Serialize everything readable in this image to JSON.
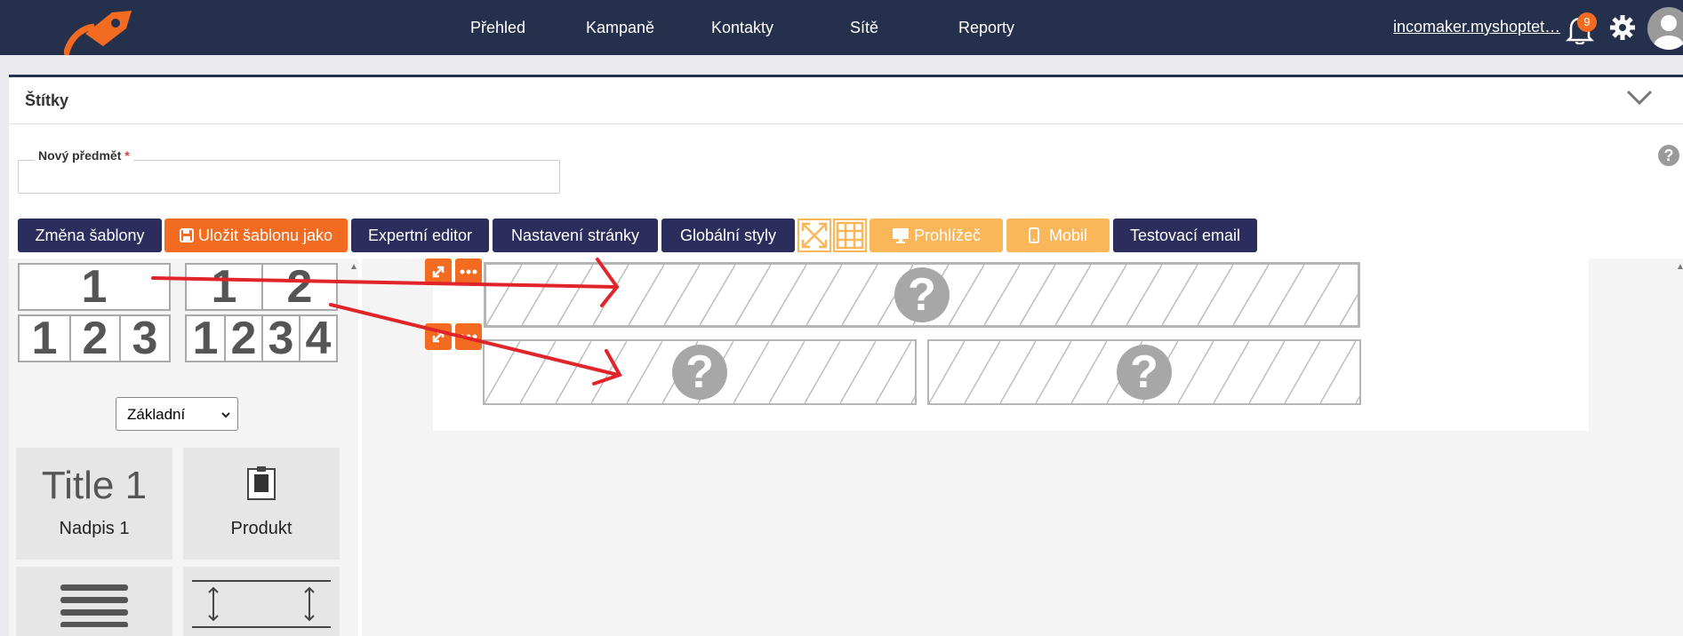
{
  "nav": {
    "items": [
      "Přehled",
      "Kampaně",
      "Kontakty",
      "Sítě",
      "Reporty"
    ],
    "user": "incomaker.myshoptet…",
    "notifications": "9"
  },
  "section": {
    "title": "Štítky"
  },
  "subject": {
    "label": "Nový předmět",
    "required_mark": "*",
    "value": ""
  },
  "toolbar": {
    "change_template": "Změna šablony",
    "save_template_as": "Uložit šablonu jako",
    "expert_editor": "Expertní editor",
    "page_settings": "Nastavení stránky",
    "global_styles": "Globální styly",
    "browser": "Prohlížeč",
    "mobile": "Mobil",
    "test_email": "Testovací email"
  },
  "layouts": {
    "one": [
      "1"
    ],
    "two": [
      "1",
      "2"
    ],
    "three": [
      "1",
      "2",
      "3"
    ],
    "four": [
      "1",
      "2",
      "3",
      "4"
    ]
  },
  "category_select": {
    "value": "Základní"
  },
  "tiles": {
    "heading": {
      "preview": "Title 1",
      "label": "Nadpis 1"
    },
    "product": {
      "label": "Produkt"
    }
  },
  "placeholder_mark": "?",
  "colors": {
    "navy": "#25304c",
    "button_navy": "#2b2d5c",
    "orange": "#f26b21",
    "light_orange": "#fbb65a",
    "annotation_red": "#e0242a"
  }
}
